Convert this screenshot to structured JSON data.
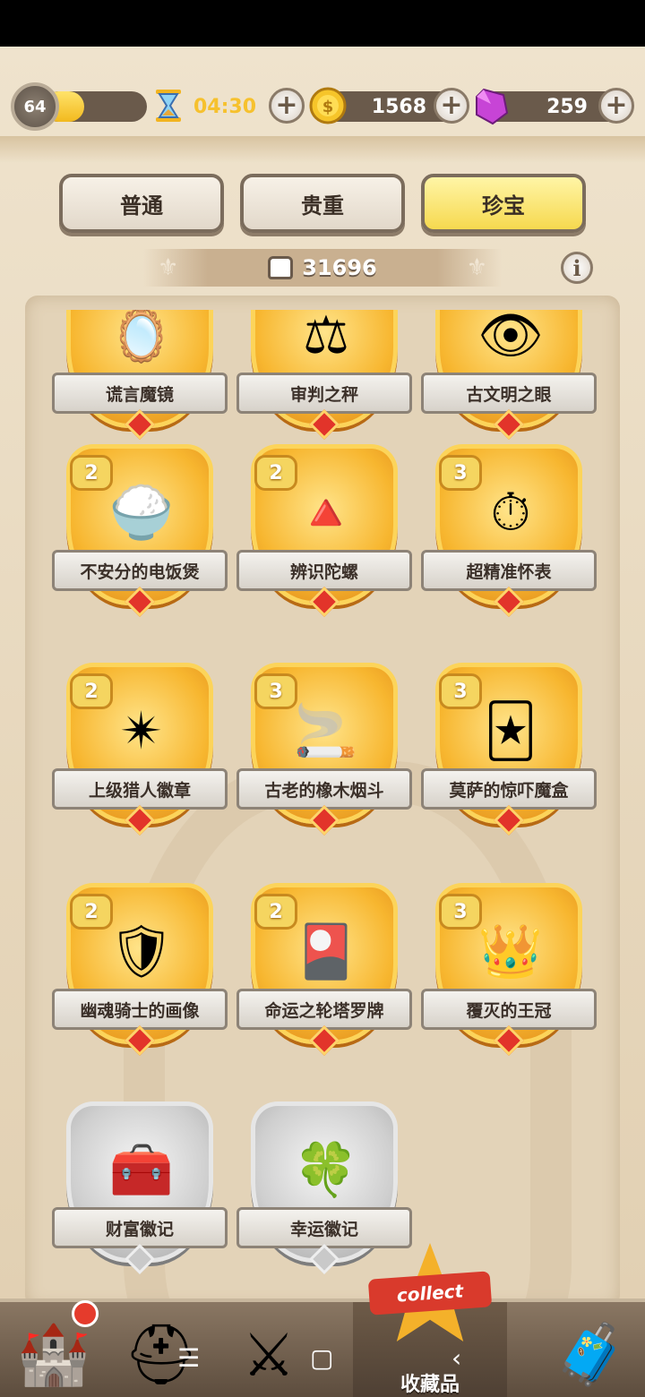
{
  "hud": {
    "level": "64",
    "xp_fraction": 0.4,
    "timer": "04:30",
    "coins": "1568",
    "gems": "259",
    "plus_symbol": "+"
  },
  "tabs": [
    {
      "label": "普通",
      "active": false
    },
    {
      "label": "贵重",
      "active": false
    },
    {
      "label": "珍宝",
      "active": true
    }
  ],
  "points": "31696",
  "info_symbol": "i",
  "cards": [
    {
      "name": "谎言魔镜",
      "count": "",
      "icon": "mirror-icon",
      "glyph": "🪞",
      "locked": false
    },
    {
      "name": "审判之秤",
      "count": "",
      "icon": "scales-icon",
      "glyph": "⚖",
      "locked": false
    },
    {
      "name": "古文明之眼",
      "count": "",
      "icon": "eye-icon",
      "glyph": "👁",
      "locked": false
    },
    {
      "name": "不安分的电饭煲",
      "count": "2",
      "icon": "rice-cooker-icon",
      "glyph": "🍚",
      "locked": false
    },
    {
      "name": "辨识陀螺",
      "count": "2",
      "icon": "spinning-top-icon",
      "glyph": "🔺",
      "locked": false
    },
    {
      "name": "超精准怀表",
      "count": "3",
      "icon": "pocket-watch-icon",
      "glyph": "⏱",
      "locked": false
    },
    {
      "name": "上级猎人徽章",
      "count": "2",
      "icon": "hunter-badge-icon",
      "glyph": "✴",
      "locked": false
    },
    {
      "name": "古老的橡木烟斗",
      "count": "3",
      "icon": "pipe-icon",
      "glyph": "🚬",
      "locked": false
    },
    {
      "name": "莫萨的惊吓魔盒",
      "count": "3",
      "icon": "jack-in-box-icon",
      "glyph": "🃏",
      "locked": false
    },
    {
      "name": "幽魂骑士的画像",
      "count": "2",
      "icon": "knight-portrait-icon",
      "glyph": "🛡",
      "locked": false
    },
    {
      "name": "命运之轮塔罗牌",
      "count": "2",
      "icon": "tarot-card-icon",
      "glyph": "🎴",
      "locked": false
    },
    {
      "name": "覆灭的王冠",
      "count": "3",
      "icon": "crown-icon",
      "glyph": "👑",
      "locked": false
    },
    {
      "name": "财富徽记",
      "count": "",
      "icon": "treasure-chest-icon",
      "glyph": "🧰",
      "locked": true
    },
    {
      "name": "幸运徽记",
      "count": "",
      "icon": "clover-icon",
      "glyph": "🍀",
      "locked": true
    }
  ],
  "bottom_nav": {
    "collect_banner": "collect",
    "collect_label": "收藏品",
    "items": [
      {
        "icon": "castle-icon",
        "glyph": "🏰"
      },
      {
        "icon": "helmet-icon",
        "glyph": "⛑"
      },
      {
        "icon": "sword-shield-icon",
        "glyph": "⚔"
      },
      {
        "icon": "collect-star-icon",
        "glyph": ""
      },
      {
        "icon": "chest-icon",
        "glyph": "🧳"
      }
    ]
  },
  "system_nav": {
    "menu": "☰",
    "home": "▢",
    "back": "‹"
  },
  "colors": {
    "gold": "#f7b62f",
    "active_tab": "#f6d94f",
    "silver": "#cfcfcf",
    "parchment": "#e9dbc4"
  }
}
